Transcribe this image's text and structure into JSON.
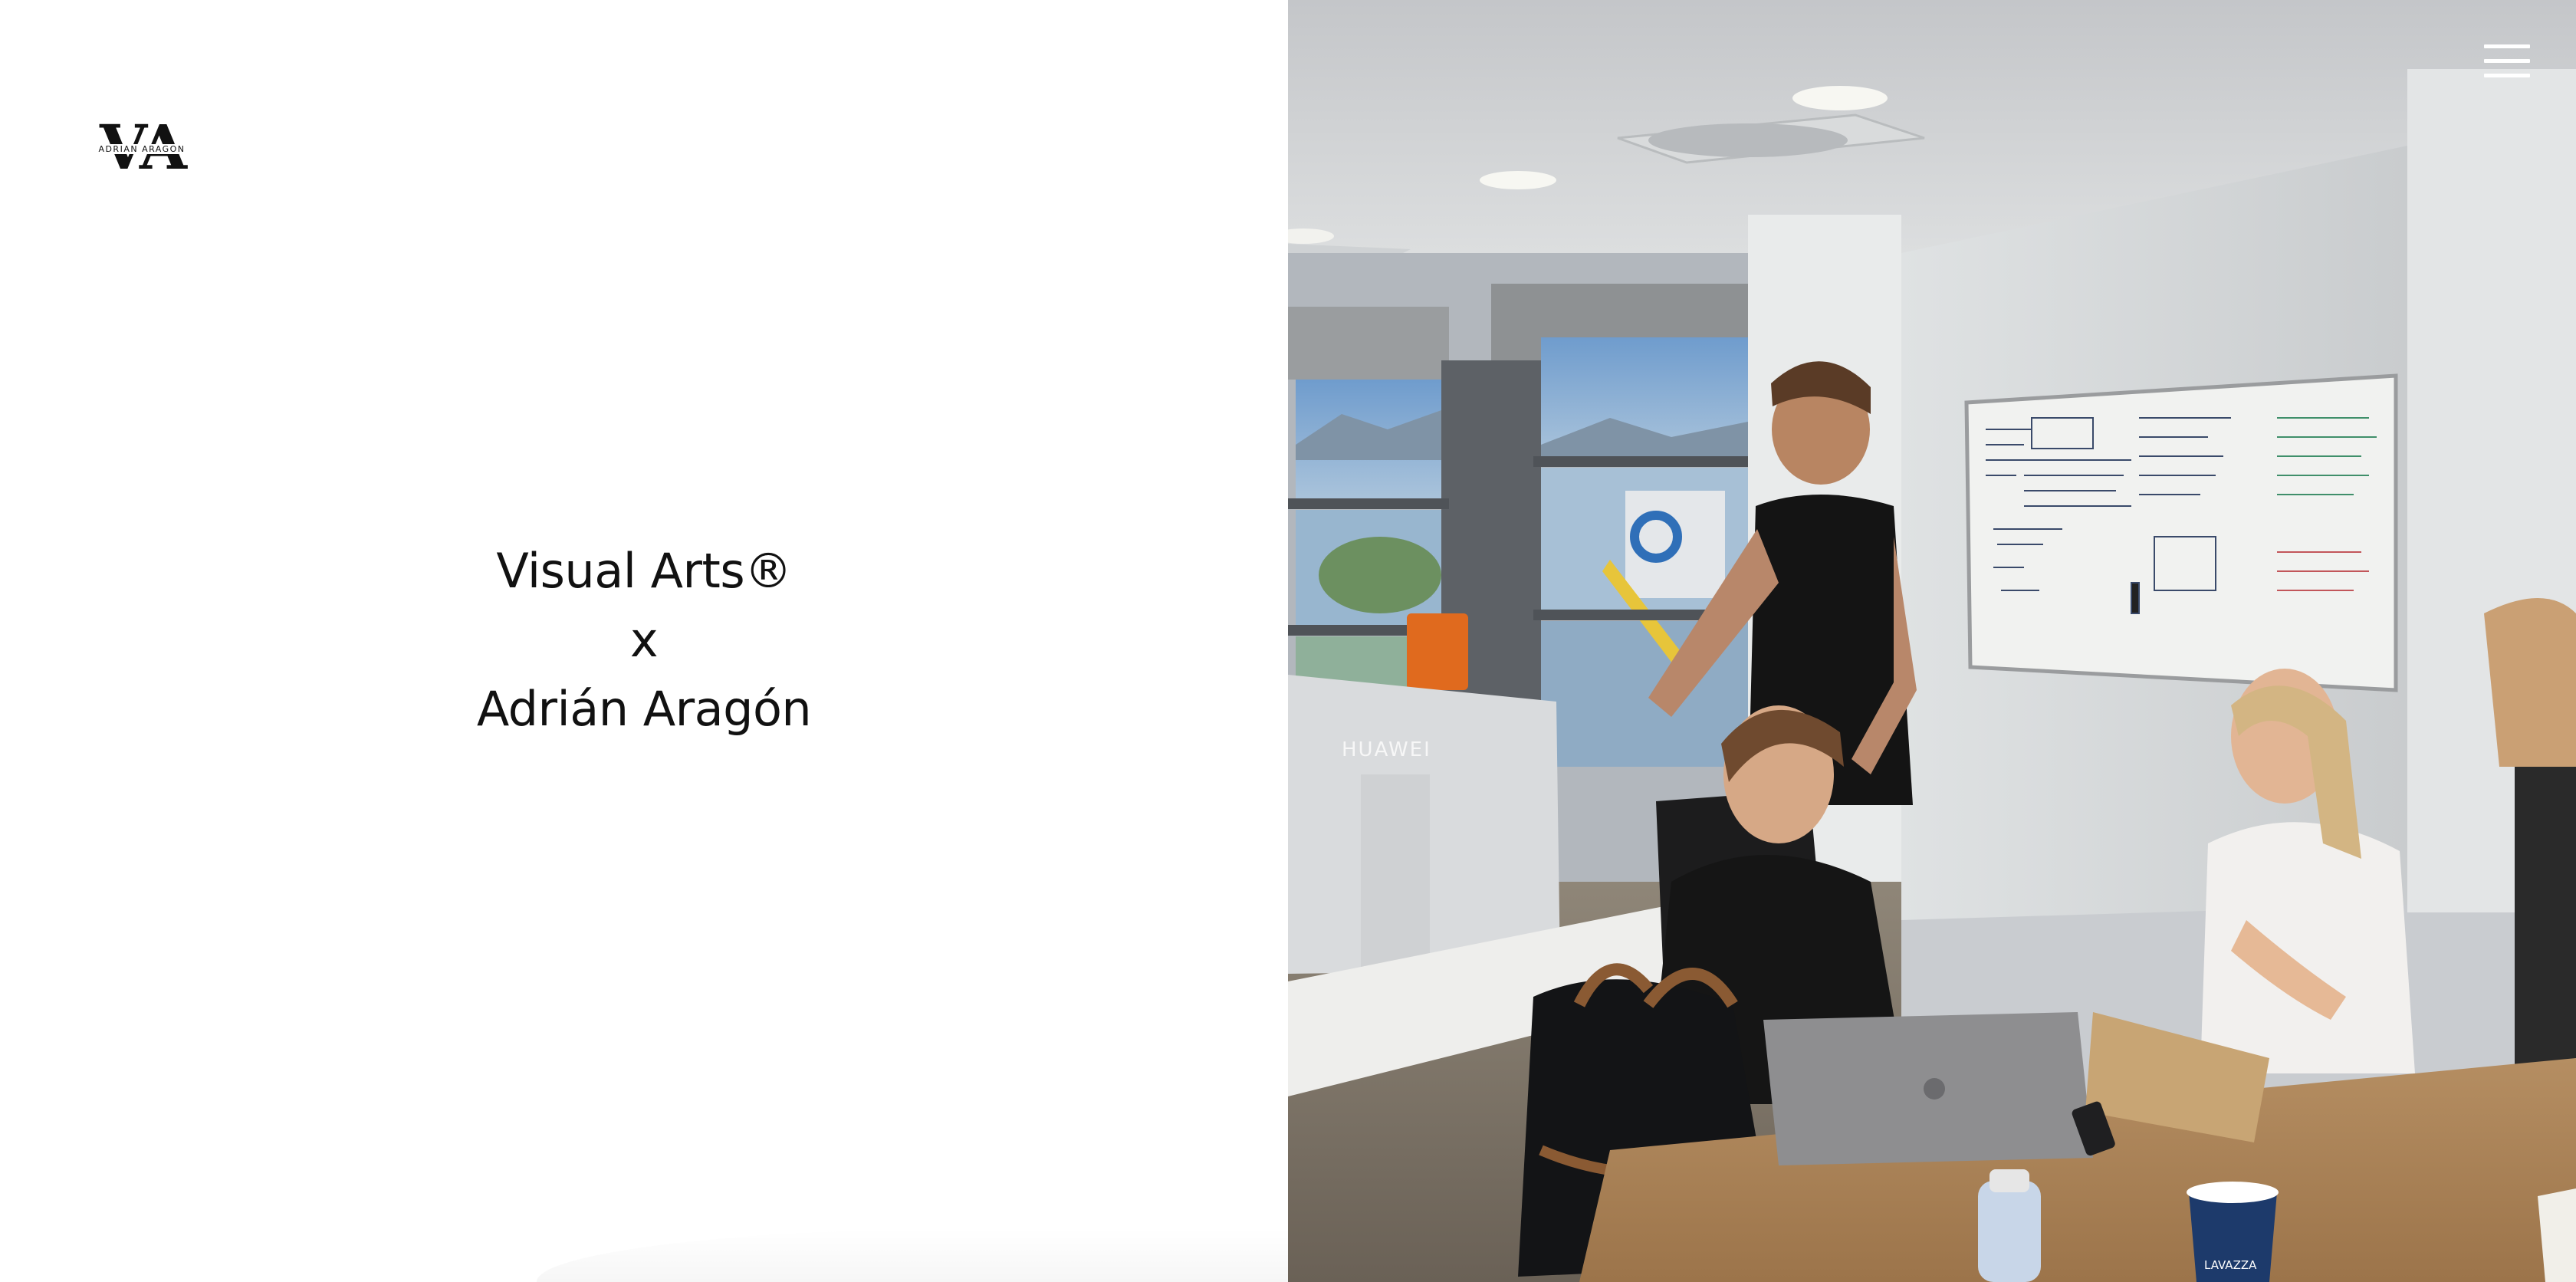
{
  "logo": {
    "letters": "VA",
    "subtext": "ADRIAN ARAGON"
  },
  "hero": {
    "line1": "Visual Arts®",
    "line2": "x",
    "line3": "Adrián Aragón"
  },
  "photo": {
    "monitor_brand": "HUAWEI",
    "cup_brand": "LAVAZZA"
  },
  "menu": {
    "icon": "hamburger-menu-icon"
  },
  "colors": {
    "background": "#ffffff",
    "text": "#111111",
    "menu_icon": "#ffffff"
  }
}
